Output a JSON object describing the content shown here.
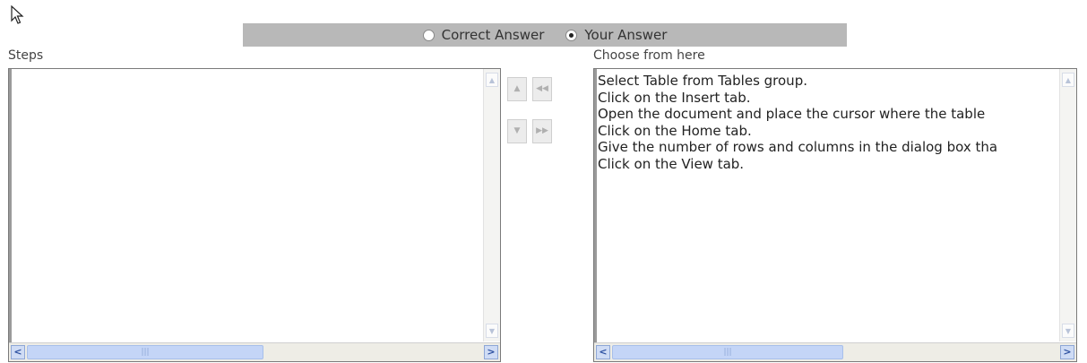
{
  "mode": {
    "options": [
      {
        "label": "Correct Answer",
        "selected": false
      },
      {
        "label": "Your Answer",
        "selected": true
      }
    ]
  },
  "steps": {
    "label": "Steps",
    "items": []
  },
  "choices": {
    "label": "Choose from here",
    "items": [
      "Select Table from Tables group.",
      "Click on the Insert tab.",
      "Open the document and place the cursor where the table",
      "Click on the Home tab.",
      "Give the number of rows and columns in the dialog box tha",
      "Click on the View tab."
    ]
  },
  "buttons": {
    "move_up": "▲",
    "move_to_steps": "◀◀",
    "move_down": "▼",
    "move_to_choices": "▶▶"
  },
  "icons": {
    "cursor": "mouse-pointer-icon"
  }
}
